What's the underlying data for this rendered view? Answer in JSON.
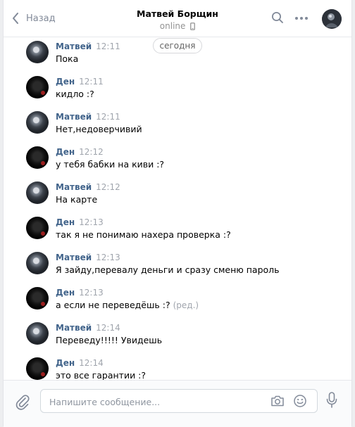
{
  "header": {
    "back_label": "Назад",
    "title": "Матвей Борщин",
    "status": "online"
  },
  "date_separator": "сегодня",
  "messages": [
    {
      "sender": "Матвей",
      "avatar": "matvey",
      "time": "12:11",
      "text": "Пока",
      "edited": ""
    },
    {
      "sender": "Ден",
      "avatar": "den",
      "time": "12:11",
      "text": "кидло :?",
      "edited": ""
    },
    {
      "sender": "Матвей",
      "avatar": "matvey",
      "time": "12:11",
      "text": "Нет,недоверчивий",
      "edited": ""
    },
    {
      "sender": "Ден",
      "avatar": "den",
      "time": "12:12",
      "text": "у тебя бабки на киви :?",
      "edited": ""
    },
    {
      "sender": "Матвей",
      "avatar": "matvey",
      "time": "12:12",
      "text": "На карте",
      "edited": ""
    },
    {
      "sender": "Ден",
      "avatar": "den",
      "time": "12:13",
      "text": "так я не понимаю нахера проверка :?",
      "edited": ""
    },
    {
      "sender": "Матвей",
      "avatar": "matvey",
      "time": "12:13",
      "text": "Я зайду,перевалу деньги и сразу сменю пароль",
      "edited": ""
    },
    {
      "sender": "Ден",
      "avatar": "den",
      "time": "12:13",
      "text": "а если не переведёшь :?",
      "edited": "(ред.)"
    },
    {
      "sender": "Матвей",
      "avatar": "matvey",
      "time": "12:14",
      "text": "Переведу!!!!! Увидешь",
      "edited": ""
    },
    {
      "sender": "Ден",
      "avatar": "den",
      "time": "12:14",
      "text": "это все гарантии :?",
      "edited": ""
    }
  ],
  "composer": {
    "placeholder": "Напишите сообщение...",
    "value": ""
  },
  "icons": {
    "back": "chevron-left-icon",
    "search": "search-icon",
    "more": "more-dots-icon",
    "attach": "paperclip-icon",
    "camera": "camera-icon",
    "emoji": "smile-icon",
    "mic": "microphone-icon",
    "phone": "mobile-phone-icon"
  },
  "colors": {
    "name": "#42648b",
    "meta": "#a0a5ad",
    "icon": "#828a99",
    "background": "#edeef0"
  }
}
